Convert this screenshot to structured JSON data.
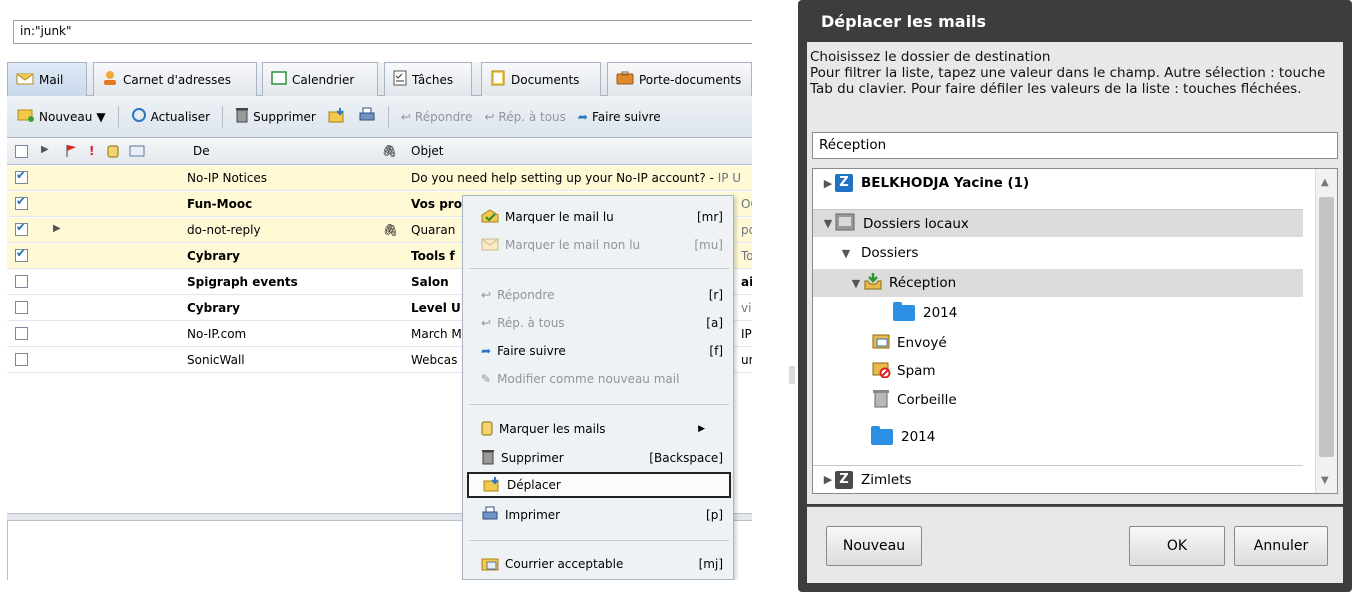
{
  "search": {
    "value": "in:\"junk\""
  },
  "tabs": [
    {
      "label": "Mail",
      "icon": "envelope-icon"
    },
    {
      "label": "Carnet d'adresses",
      "icon": "contacts-icon"
    },
    {
      "label": "Calendrier",
      "icon": "calendar-icon"
    },
    {
      "label": "Tâches",
      "icon": "tasks-icon"
    },
    {
      "label": "Documents",
      "icon": "documents-icon"
    },
    {
      "label": "Porte-documents",
      "icon": "briefcase-icon"
    }
  ],
  "toolbar": {
    "new": "Nouveau",
    "refresh": "Actualiser",
    "delete": "Supprimer",
    "reply": "Répondre",
    "reply_all": "Rép. à tous",
    "forward": "Faire suivre"
  },
  "list_header": {
    "from": "De",
    "subject": "Objet"
  },
  "messages": [
    {
      "from": "No-IP Notices",
      "subject": "Do you need help setting up your No-IP account? -",
      "subject_tail": "IP U",
      "unread": false,
      "checked": true
    },
    {
      "from": "Fun-Mooc",
      "subject": "Vos pro",
      "subject_tail": "OOC",
      "unread": true,
      "checked": true
    },
    {
      "from": "do-not-reply",
      "subject": "Quaran",
      "subject_tail": "por",
      "unread": false,
      "checked": true
    },
    {
      "from": "Cybrary",
      "subject": "Tools f",
      "subject_tail": "To",
      "unread": true,
      "checked": true
    },
    {
      "from": "Spigraph events",
      "subject": "Salon",
      "subject_tail": "ail",
      "unread": true,
      "checked": false
    },
    {
      "from": "Cybrary",
      "subject": "Level U",
      "subject_tail": "vi",
      "unread": true,
      "checked": false
    },
    {
      "from": "No-IP.com",
      "subject": "March M",
      "subject_tail": "IP",
      "unread": false,
      "checked": false
    },
    {
      "from": "SonicWall",
      "subject": "Webcas",
      "subject_tail": "ur",
      "unread": false,
      "checked": false
    }
  ],
  "context_menu": {
    "mark_read": "Marquer le mail lu",
    "mark_read_sc": "[mr]",
    "mark_unread": "Marquer le mail non lu",
    "mark_unread_sc": "[mu]",
    "reply": "Répondre",
    "reply_sc": "[r]",
    "reply_all": "Rép. à tous",
    "reply_all_sc": "[a]",
    "forward": "Faire suivre",
    "forward_sc": "[f]",
    "edit_new": "Modifier comme nouveau mail",
    "mark_mails": "Marquer les mails",
    "delete": "Supprimer",
    "delete_sc": "[Backspace]",
    "move": "Déplacer",
    "print": "Imprimer",
    "print_sc": "[p]",
    "not_junk": "Courrier acceptable",
    "not_junk_sc": "[mj]"
  },
  "dialog": {
    "title": "Déplacer les mails",
    "instructions": "Choisissez le dossier de destination\nPour filtrer la liste, tapez une valeur dans le champ. Autre sélection : touche Tab du clavier. Pour faire défiler les valeurs de la liste : touches fléchées.",
    "input_value": "Réception",
    "tree": {
      "account": "BELKHODJA Yacine (1)",
      "local": "Dossiers locaux",
      "folders": "Dossiers",
      "inbox": "Réception",
      "inbox_sub": "2014",
      "sent": "Envoyé",
      "spam": "Spam",
      "trash": "Corbeille",
      "folder_2014": "2014",
      "zimlets": "Zimlets"
    },
    "buttons": {
      "new": "Nouveau",
      "ok": "OK",
      "cancel": "Annuler"
    }
  }
}
